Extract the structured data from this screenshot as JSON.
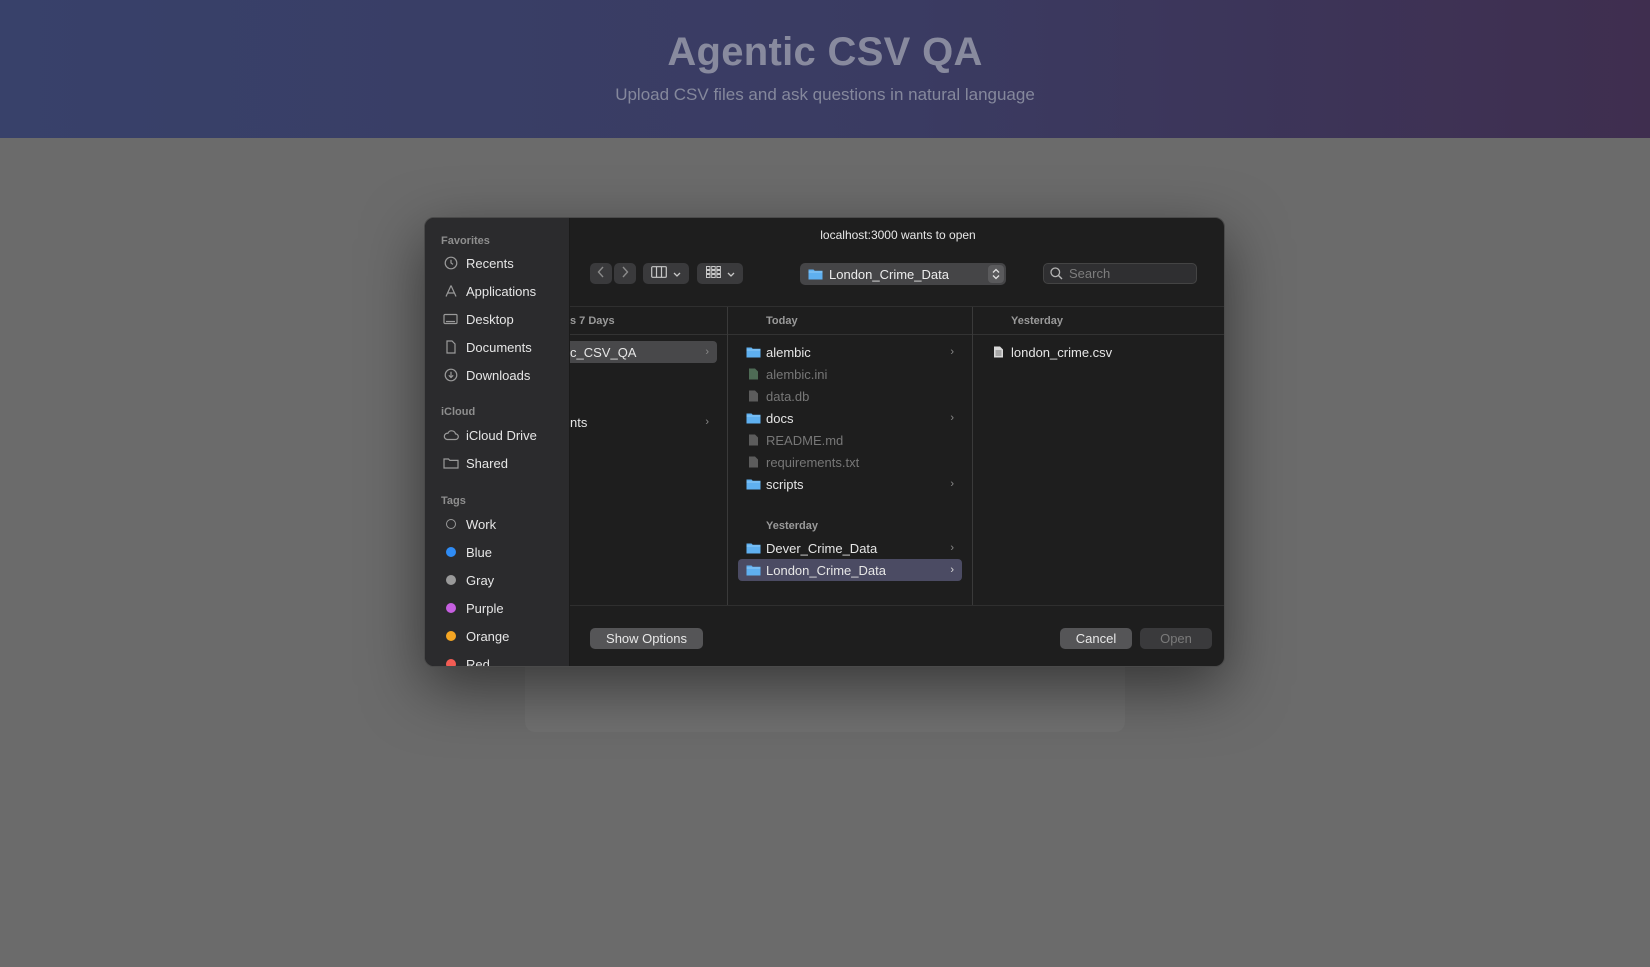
{
  "app": {
    "title": "Agentic CSV QA",
    "subtitle": "Upload CSV files and ask questions in natural language"
  },
  "dialog": {
    "title": "localhost:3000 wants to open",
    "sidebar": {
      "favorites_label": "Favorites",
      "favorites": [
        {
          "label": "Recents",
          "icon": "clock-icon"
        },
        {
          "label": "Applications",
          "icon": "applications-icon"
        },
        {
          "label": "Desktop",
          "icon": "desktop-icon"
        },
        {
          "label": "Documents",
          "icon": "document-icon"
        },
        {
          "label": "Downloads",
          "icon": "download-icon"
        }
      ],
      "icloud_label": "iCloud",
      "icloud": [
        {
          "label": "iCloud Drive",
          "icon": "cloud-icon"
        },
        {
          "label": "Shared",
          "icon": "shared-folder-icon"
        }
      ],
      "tags_label": "Tags",
      "tags": [
        {
          "label": "Work",
          "color": "hollow"
        },
        {
          "label": "Blue",
          "color": "#2f8cf5"
        },
        {
          "label": "Gray",
          "color": "#9a9a9a"
        },
        {
          "label": "Purple",
          "color": "#c65fe0"
        },
        {
          "label": "Orange",
          "color": "#f5a623"
        },
        {
          "label": "Red",
          "color": "#f25c54"
        }
      ]
    },
    "toolbar": {
      "location": "London_Crime_Data",
      "search_placeholder": "Search"
    },
    "columns": {
      "col1": {
        "header": "s 7 Days",
        "items": [
          {
            "label": "c_CSV_QA",
            "selected": true
          },
          {
            "label": "nts",
            "selected": false
          }
        ]
      },
      "col2": {
        "header": "Today",
        "today": [
          {
            "label": "alembic",
            "type": "folder"
          },
          {
            "label": "alembic.ini",
            "type": "file-green"
          },
          {
            "label": "data.db",
            "type": "file"
          },
          {
            "label": "docs",
            "type": "folder"
          },
          {
            "label": "README.md",
            "type": "file"
          },
          {
            "label": "requirements.txt",
            "type": "file"
          },
          {
            "label": "scripts",
            "type": "folder"
          }
        ],
        "yesterday_label": "Yesterday",
        "yesterday": [
          {
            "label": "Dever_Crime_Data",
            "type": "folder"
          },
          {
            "label": "London_Crime_Data",
            "type": "folder"
          }
        ]
      },
      "col3": {
        "header": "Yesterday",
        "items": [
          {
            "label": "london_crime.csv",
            "type": "csv"
          }
        ]
      }
    },
    "footer": {
      "show_options": "Show Options",
      "cancel": "Cancel",
      "open": "Open"
    },
    "colors": {
      "folder": "#5fb0f0",
      "accent": "#2f8cf5"
    }
  }
}
